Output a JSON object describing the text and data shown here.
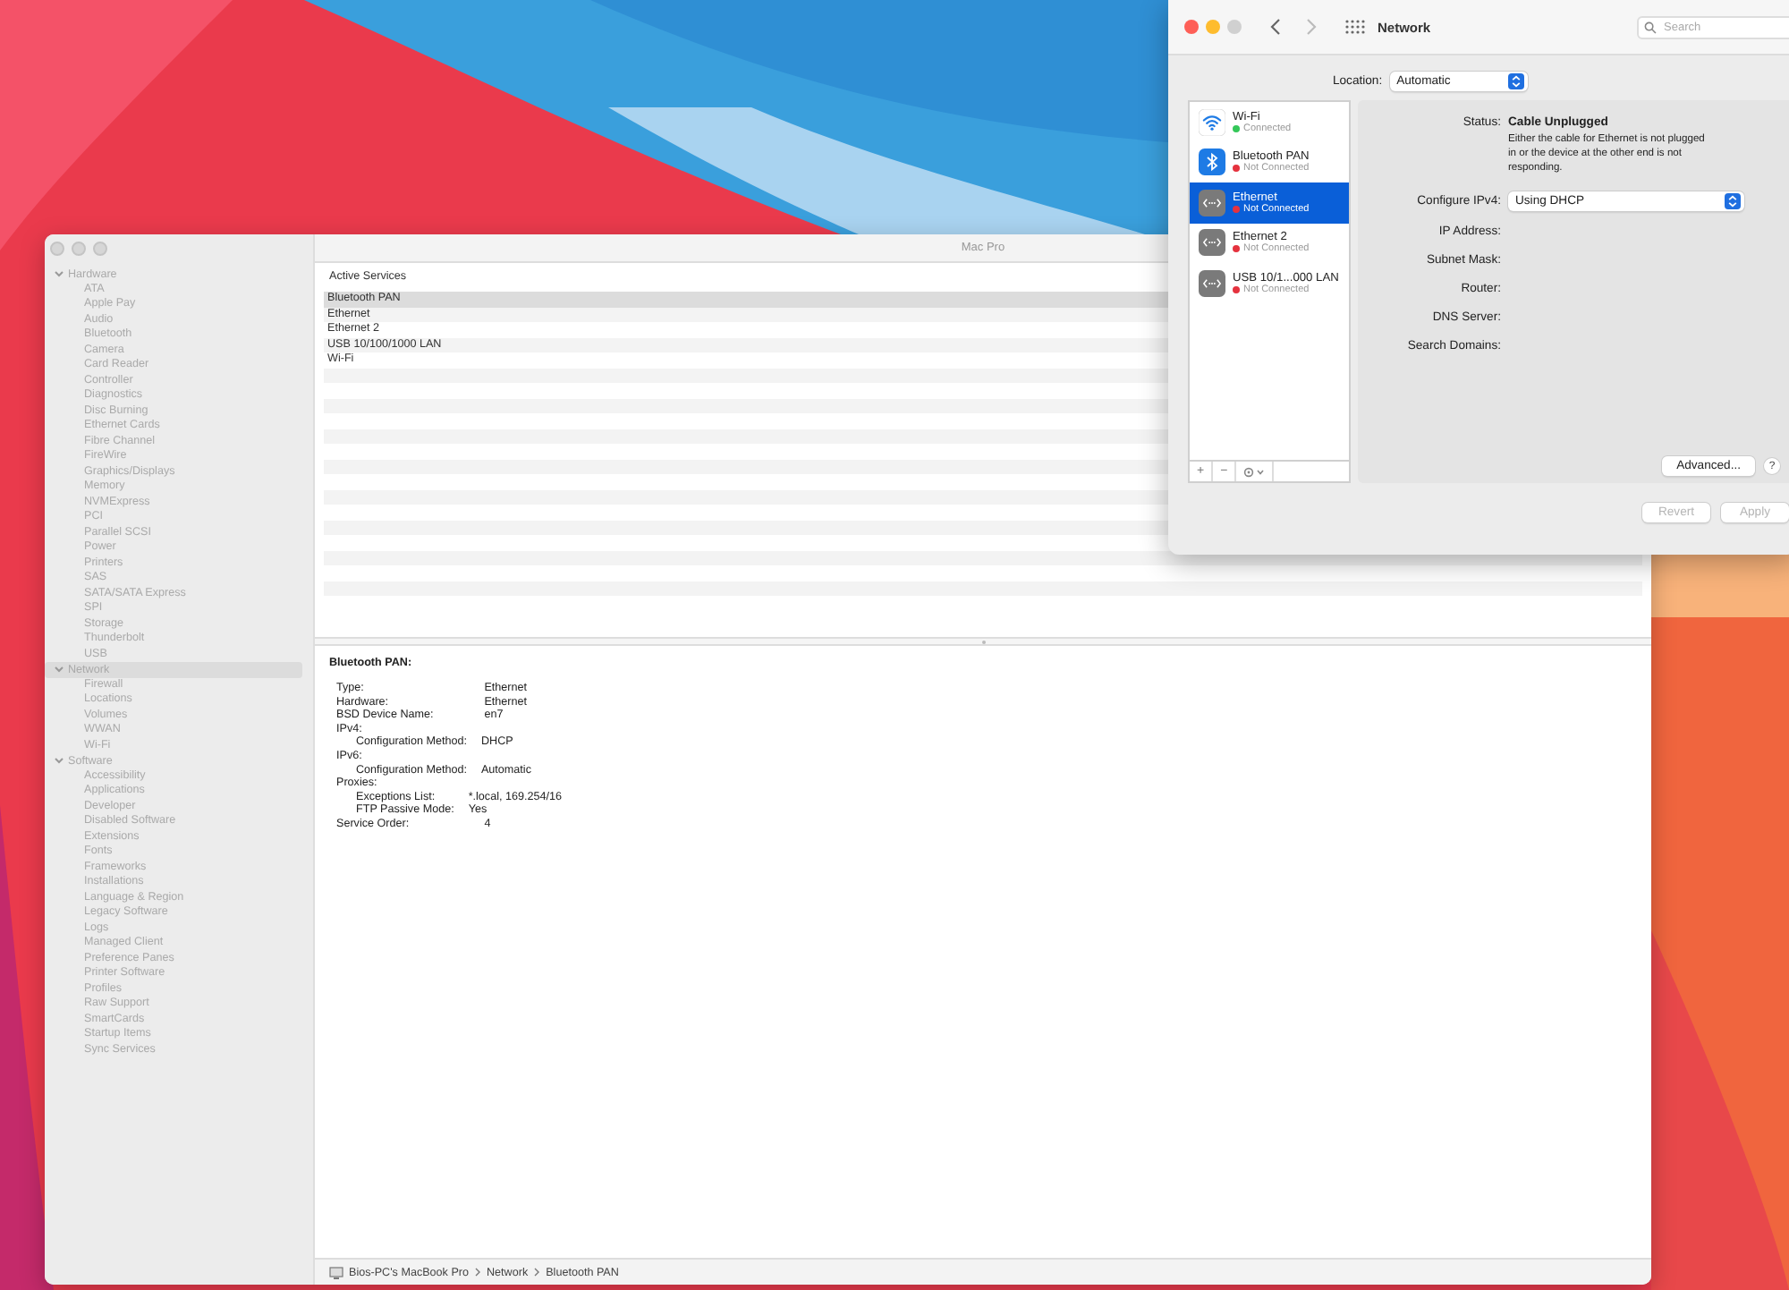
{
  "system_info": {
    "title": "Mac Pro",
    "sidebar": [
      {
        "label": "Hardware",
        "expanded": true,
        "selected": false,
        "children": [
          {
            "label": "ATA"
          },
          {
            "label": "Apple Pay"
          },
          {
            "label": "Audio"
          },
          {
            "label": "Bluetooth"
          },
          {
            "label": "Camera"
          },
          {
            "label": "Card Reader"
          },
          {
            "label": "Controller"
          },
          {
            "label": "Diagnostics"
          },
          {
            "label": "Disc Burning"
          },
          {
            "label": "Ethernet Cards"
          },
          {
            "label": "Fibre Channel"
          },
          {
            "label": "FireWire"
          },
          {
            "label": "Graphics/Displays"
          },
          {
            "label": "Memory"
          },
          {
            "label": "NVMExpress"
          },
          {
            "label": "PCI"
          },
          {
            "label": "Parallel SCSI"
          },
          {
            "label": "Power"
          },
          {
            "label": "Printers"
          },
          {
            "label": "SAS"
          },
          {
            "label": "SATA/SATA Express"
          },
          {
            "label": "SPI"
          },
          {
            "label": "Storage"
          },
          {
            "label": "Thunderbolt"
          },
          {
            "label": "USB"
          }
        ]
      },
      {
        "label": "Network",
        "expanded": true,
        "selected": true,
        "children": [
          {
            "label": "Firewall"
          },
          {
            "label": "Locations"
          },
          {
            "label": "Volumes"
          },
          {
            "label": "WWAN"
          },
          {
            "label": "Wi-Fi"
          }
        ]
      },
      {
        "label": "Software",
        "expanded": true,
        "selected": false,
        "children": [
          {
            "label": "Accessibility"
          },
          {
            "label": "Applications"
          },
          {
            "label": "Developer"
          },
          {
            "label": "Disabled Software"
          },
          {
            "label": "Extensions"
          },
          {
            "label": "Fonts"
          },
          {
            "label": "Frameworks"
          },
          {
            "label": "Installations"
          },
          {
            "label": "Language & Region"
          },
          {
            "label": "Legacy Software"
          },
          {
            "label": "Logs"
          },
          {
            "label": "Managed Client"
          },
          {
            "label": "Preference Panes"
          },
          {
            "label": "Printer Software"
          },
          {
            "label": "Profiles"
          },
          {
            "label": "Raw Support"
          },
          {
            "label": "SmartCards"
          },
          {
            "label": "Startup Items"
          },
          {
            "label": "Sync Services"
          }
        ]
      }
    ],
    "services": {
      "heading": "Active Services",
      "rows": [
        {
          "label": "Bluetooth PAN",
          "selected": true
        },
        {
          "label": "Ethernet",
          "selected": false
        },
        {
          "label": "Ethernet 2",
          "selected": false
        },
        {
          "label": "USB 10/100/1000 LAN",
          "selected": false
        },
        {
          "label": "Wi-Fi",
          "selected": false
        }
      ]
    },
    "detail": {
      "title": "Bluetooth PAN:",
      "lines": [
        {
          "label": "Type:",
          "value": "Ethernet"
        },
        {
          "label": "Hardware:",
          "value": "Ethernet"
        },
        {
          "label": "BSD Device Name:",
          "value": "en7"
        },
        {
          "label": "IPv4:",
          "children": [
            {
              "label": "Configuration Method:",
              "value": "DHCP"
            }
          ]
        },
        {
          "label": "IPv6:",
          "children": [
            {
              "label": "Configuration Method:",
              "value": "Automatic"
            }
          ]
        },
        {
          "label": "Proxies:",
          "children": [
            {
              "label": "Exceptions List:",
              "value": "*.local, 169.254/16"
            },
            {
              "label": "FTP Passive Mode:",
              "value": "Yes"
            }
          ]
        },
        {
          "label": "Service Order:",
          "value": "4"
        }
      ]
    },
    "path": [
      "Bios-PC's MacBook Pro",
      "Network",
      "Bluetooth PAN"
    ]
  },
  "network": {
    "title": "Network",
    "search": {
      "placeholder": "Search"
    },
    "location": {
      "label": "Location:",
      "value": "Automatic"
    },
    "services": [
      {
        "name": "Wi-Fi",
        "status": "Connected",
        "color": "#34c759",
        "kind": "wifi",
        "selected": false
      },
      {
        "name": "Bluetooth PAN",
        "status": "Not Connected",
        "color": "#e5323e",
        "kind": "bluetooth",
        "selected": false
      },
      {
        "name": "Ethernet",
        "status": "Not Connected",
        "color": "#e5323e",
        "kind": "ethernet",
        "selected": true
      },
      {
        "name": "Ethernet 2",
        "status": "Not Connected",
        "color": "#e5323e",
        "kind": "ethernet",
        "selected": false
      },
      {
        "name": "USB 10/1...000 LAN",
        "status": "Not Connected",
        "color": "#e5323e",
        "kind": "ethernet",
        "selected": false
      }
    ],
    "list_buttons": [
      "+",
      "−"
    ],
    "status": {
      "label": "Status:",
      "value": "Cable Unplugged",
      "note": "Either the cable for Ethernet is not plugged in or the device at the other end is not responding."
    },
    "configure": {
      "label": "Configure IPv4:",
      "value": "Using DHCP"
    },
    "fields": [
      "IP Address:",
      "Subnet Mask:",
      "Router:",
      "DNS Server:",
      "Search Domains:"
    ],
    "advanced": "Advanced...",
    "help": "?",
    "actions": [
      {
        "label": "Revert",
        "disabled": true
      },
      {
        "label": "Apply",
        "disabled": true
      }
    ]
  }
}
